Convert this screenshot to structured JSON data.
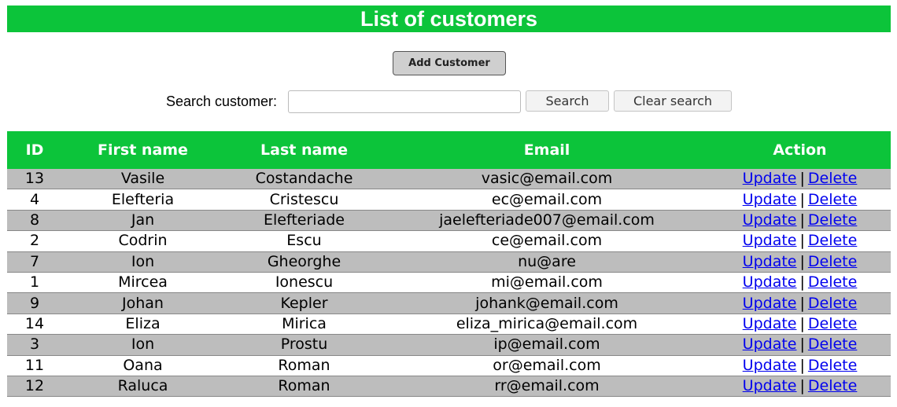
{
  "page": {
    "title": "List of customers",
    "add_button_label": "Add Customer"
  },
  "search": {
    "label": "Search customer:",
    "value": "",
    "placeholder": "",
    "search_button_label": "Search",
    "clear_button_label": "Clear search"
  },
  "colors": {
    "accent": "#0cc43a",
    "row_shaded": "#bdbdbd",
    "link": "#0000ee"
  },
  "table": {
    "headers": [
      "ID",
      "First name",
      "Last name",
      "Email",
      "Action"
    ],
    "separator": "|",
    "rows": [
      {
        "id": "13",
        "first_name": "Vasile",
        "last_name": "Costandache",
        "email": "vasic@email.com",
        "update": "Update",
        "delete": "Delete"
      },
      {
        "id": "4",
        "first_name": "Elefteria",
        "last_name": "Cristescu",
        "email": "ec@email.com",
        "update": "Update",
        "delete": "Delete"
      },
      {
        "id": "8",
        "first_name": "Jan",
        "last_name": "Elefteriade",
        "email": "jaelefteriade007@email.com",
        "update": "Update",
        "delete": "Delete"
      },
      {
        "id": "2",
        "first_name": "Codrin",
        "last_name": "Escu",
        "email": "ce@email.com",
        "update": "Update",
        "delete": "Delete"
      },
      {
        "id": "7",
        "first_name": "Ion",
        "last_name": "Gheorghe",
        "email": "nu@are",
        "update": "Update",
        "delete": "Delete"
      },
      {
        "id": "1",
        "first_name": "Mircea",
        "last_name": "Ionescu",
        "email": "mi@email.com",
        "update": "Update",
        "delete": "Delete"
      },
      {
        "id": "9",
        "first_name": "Johan",
        "last_name": "Kepler",
        "email": "johank@email.com",
        "update": "Update",
        "delete": "Delete"
      },
      {
        "id": "14",
        "first_name": "Eliza",
        "last_name": "Mirica",
        "email": "eliza_mirica@email.com",
        "update": "Update",
        "delete": "Delete"
      },
      {
        "id": "3",
        "first_name": "Ion",
        "last_name": "Prostu",
        "email": "ip@email.com",
        "update": "Update",
        "delete": "Delete"
      },
      {
        "id": "11",
        "first_name": "Oana",
        "last_name": "Roman",
        "email": "or@email.com",
        "update": "Update",
        "delete": "Delete"
      },
      {
        "id": "12",
        "first_name": "Raluca",
        "last_name": "Roman",
        "email": "rr@email.com",
        "update": "Update",
        "delete": "Delete"
      }
    ]
  }
}
